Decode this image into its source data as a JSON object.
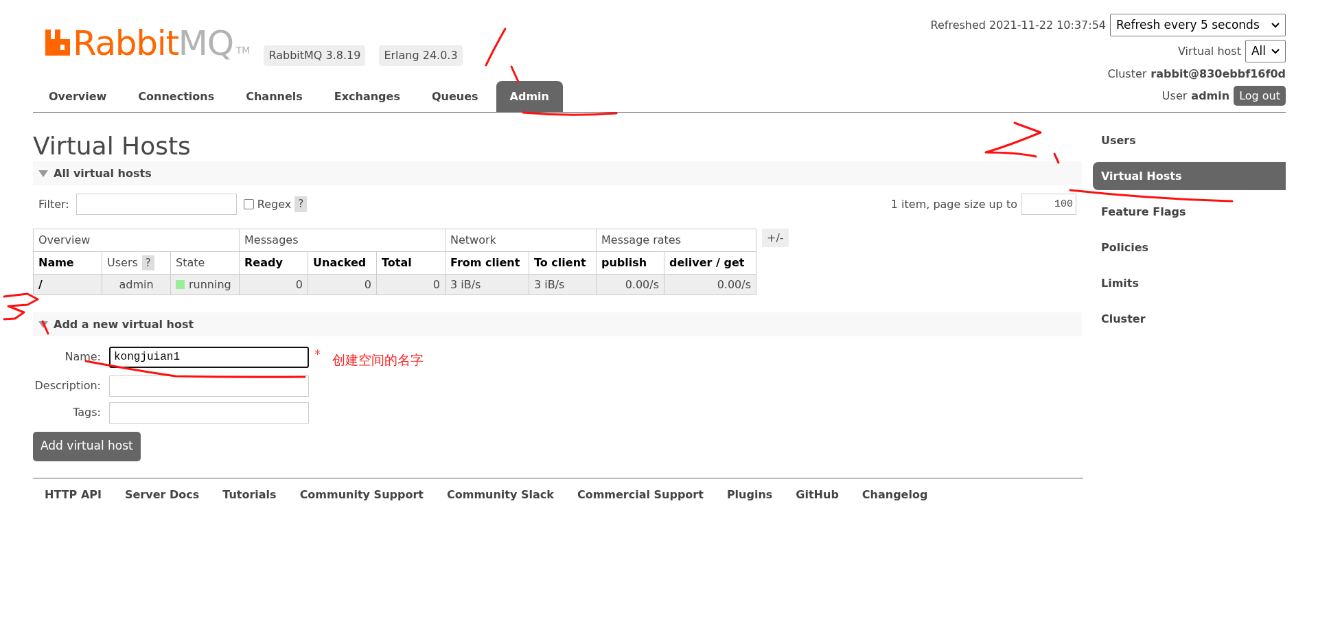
{
  "logo": {
    "brand": "Rabbit",
    "suffix": "MQ",
    "trademark": "TM"
  },
  "versions": [
    "RabbitMQ 3.8.19",
    "Erlang 24.0.3"
  ],
  "tabs": [
    {
      "label": "Overview",
      "selected": false
    },
    {
      "label": "Connections",
      "selected": false
    },
    {
      "label": "Channels",
      "selected": false
    },
    {
      "label": "Exchanges",
      "selected": false
    },
    {
      "label": "Queues",
      "selected": false
    },
    {
      "label": "Admin",
      "selected": true
    }
  ],
  "status": {
    "refreshed": "Refreshed 2021-11-22 10:37:54",
    "refresh_select": "Refresh every 5 seconds",
    "vhost_label": "Virtual host",
    "vhost_select": "All",
    "cluster_label": "Cluster",
    "cluster": "rabbit@830ebbf16f0d",
    "user_label": "User",
    "user": "admin",
    "logout": "Log out"
  },
  "page_title": "Virtual Hosts",
  "all_section": {
    "title": "All virtual hosts",
    "expanded": true,
    "filter_label": "Filter:",
    "regex": {
      "label": "Regex",
      "checked": false
    },
    "help": "?",
    "paging": "1 item, page size up to",
    "page_size": "100"
  },
  "table": {
    "toggle": "+/-",
    "groups": [
      {
        "label": "Overview",
        "columns": [
          {
            "label": "Name",
            "sortable": true
          },
          {
            "label": "Users",
            "sortable": false,
            "help": "?"
          },
          {
            "label": "State",
            "sortable": false
          }
        ]
      },
      {
        "label": "Messages",
        "columns": [
          {
            "label": "Ready",
            "sortable": true
          },
          {
            "label": "Unacked",
            "sortable": true
          },
          {
            "label": "Total",
            "sortable": true
          }
        ]
      },
      {
        "label": "Network",
        "columns": [
          {
            "label": "From client",
            "sortable": true
          },
          {
            "label": "To client",
            "sortable": true
          }
        ]
      },
      {
        "label": "Message rates",
        "columns": [
          {
            "label": "publish",
            "sortable": true
          },
          {
            "label": "deliver / get",
            "sortable": true
          }
        ]
      }
    ],
    "rows": [
      {
        "cells": [
          {
            "kind": "name",
            "text": "/"
          },
          {
            "kind": "center",
            "text": "admin"
          },
          {
            "kind": "state",
            "text": "running",
            "color": "#99ee99"
          },
          {
            "kind": "number",
            "text": "0"
          },
          {
            "kind": "number",
            "text": "0"
          },
          {
            "kind": "number",
            "text": "0"
          },
          {
            "kind": "text",
            "text": "3 iB/s"
          },
          {
            "kind": "text",
            "text": "3 iB/s"
          },
          {
            "kind": "number",
            "text": "0.00/s"
          },
          {
            "kind": "number",
            "text": "0.00/s"
          }
        ]
      }
    ]
  },
  "add_section": {
    "title": "Add a new virtual host",
    "expanded": true,
    "fields": [
      {
        "label": "Name:",
        "value": "kongjuian1",
        "required": "*",
        "focused": true
      },
      {
        "label": "Description:",
        "focused": false
      },
      {
        "label": "Tags:",
        "focused": false
      }
    ],
    "submit": "Add virtual host"
  },
  "annotation": "创建空间的名字",
  "sidebar": [
    {
      "label": "Users",
      "selected": false
    },
    {
      "label": "Virtual Hosts",
      "selected": true
    },
    {
      "label": "Feature Flags",
      "selected": false
    },
    {
      "label": "Policies",
      "selected": false
    },
    {
      "label": "Limits",
      "selected": false
    },
    {
      "label": "Cluster",
      "selected": false
    }
  ],
  "footer": [
    "HTTP API",
    "Server Docs",
    "Tutorials",
    "Community Support",
    "Community Slack",
    "Commercial Support",
    "Plugins",
    "GitHub",
    "Changelog"
  ]
}
